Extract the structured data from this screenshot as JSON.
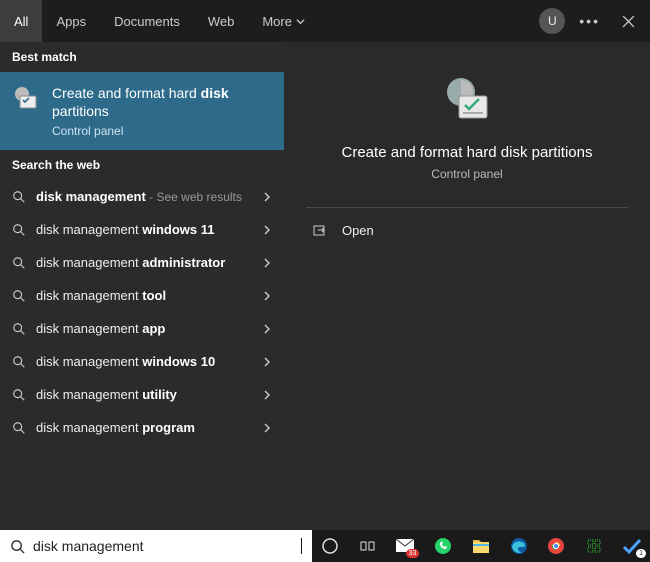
{
  "tabs": {
    "all": "All",
    "apps": "Apps",
    "documents": "Documents",
    "web": "Web",
    "more": "More"
  },
  "user_initial": "U",
  "sections": {
    "best_match": "Best match",
    "search_web": "Search the web"
  },
  "best_match": {
    "title_pre": "Create and format hard ",
    "title_bold": "disk",
    "title_post": " partitions",
    "subtitle": "Control panel"
  },
  "web_results": [
    {
      "pre": "",
      "bold": "disk management",
      "post": "",
      "hint": " - See web results"
    },
    {
      "pre": "disk management ",
      "bold": "windows 11",
      "post": "",
      "hint": ""
    },
    {
      "pre": "disk management ",
      "bold": "administrator",
      "post": "",
      "hint": ""
    },
    {
      "pre": "disk management ",
      "bold": "tool",
      "post": "",
      "hint": ""
    },
    {
      "pre": "disk management ",
      "bold": "app",
      "post": "",
      "hint": ""
    },
    {
      "pre": "disk management ",
      "bold": "windows 10",
      "post": "",
      "hint": ""
    },
    {
      "pre": "disk management ",
      "bold": "utility",
      "post": "",
      "hint": ""
    },
    {
      "pre": "disk management ",
      "bold": "program",
      "post": "",
      "hint": ""
    }
  ],
  "preview": {
    "title": "Create and format hard disk partitions",
    "subtitle": "Control panel",
    "open": "Open"
  },
  "search": {
    "value": "disk management"
  },
  "taskbar": {
    "mail_badge": "33",
    "status_badge": "1"
  }
}
